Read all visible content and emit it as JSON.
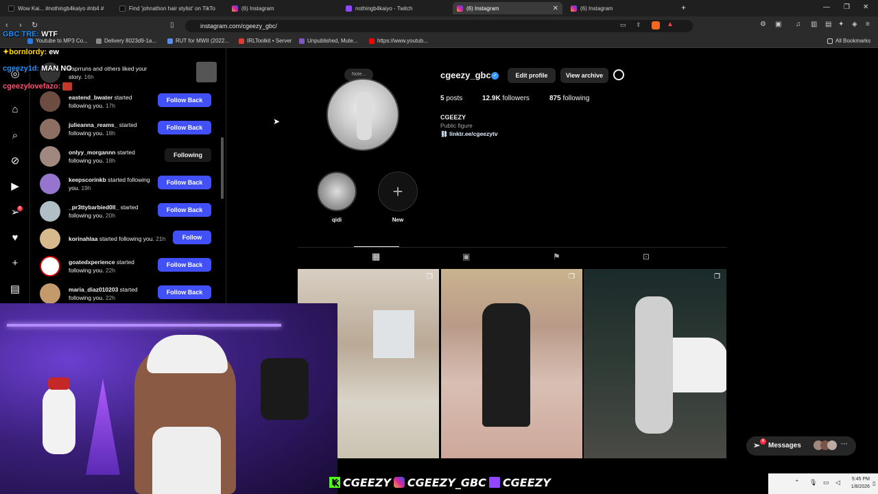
{
  "browser": {
    "tabs": [
      {
        "label": "Wow Kai... #nothingb4kaiyo #nb4 #",
        "icon": "tiktok-icon"
      },
      {
        "label": "Find 'johnathon hair stylist' on TikTo",
        "icon": "tiktok-icon"
      },
      {
        "label": "(6) Instagram",
        "icon": "instagram-icon"
      },
      {
        "label": "nothingb4kaiyo - Twitch",
        "icon": "twitch-icon"
      },
      {
        "label": "(6) Instagram",
        "icon": "instagram-icon"
      },
      {
        "label": "(6) Instagram",
        "icon": "instagram-icon"
      }
    ],
    "new_tab": "+",
    "url": "instagram.com/cgeezy_gbc/",
    "bookmarks": [
      {
        "label": "Youtube to MP3 Co..."
      },
      {
        "label": "Delivery 8023d9-1a..."
      },
      {
        "label": "RUT for MWII (2022..."
      },
      {
        "label": "IRLToolkit • Server"
      },
      {
        "label": "Unpublished, Mute..."
      },
      {
        "label": "https://www.youtub..."
      }
    ],
    "all_bookmarks": "All Bookmarks"
  },
  "chat": {
    "line1_user": "GBC TRE:",
    "line1_msg": "WTF",
    "line2_user": "bornlordy:",
    "line2_msg": "ew",
    "line3_user": "cgeezy1d:",
    "line3_msg": "MAN NO",
    "line4_user": "cgeezylovefazo:"
  },
  "notifications": [
    {
      "user": "",
      "text": "kaprruns and others liked your story.",
      "time": "16h",
      "button": ""
    },
    {
      "user": "eastend_bwater",
      "text": " started following you.",
      "time": "17h",
      "button": "Follow Back"
    },
    {
      "user": "julieanna_reams_",
      "text": " started following you.",
      "time": "18h",
      "button": "Follow Back"
    },
    {
      "user": "onlyy_morgannn",
      "text": " started following you.",
      "time": "18h",
      "button": "Following"
    },
    {
      "user": "keepscorinkb",
      "text": " started following you.",
      "time": "19h",
      "button": "Follow Back"
    },
    {
      "user": "_pr3ttybarbied0ll_",
      "text": " started following you.",
      "time": "20h",
      "button": "Follow Back"
    },
    {
      "user": "korinahlaa",
      "text": " started following you.",
      "time": "21h",
      "button": "Follow"
    },
    {
      "user": "goatedxperience",
      "text": " started following you.",
      "time": "22h",
      "button": "Follow Back"
    },
    {
      "user": "maria_diaz010203",
      "text": " started following you.",
      "time": "22h",
      "button": "Follow Back"
    }
  ],
  "profile": {
    "note": "Note...",
    "username": "cgeezy_gbc",
    "edit_profile": "Edit profile",
    "view_archive": "View archive",
    "posts_count": "5",
    "posts_label": "posts",
    "followers_count": "12.9K",
    "followers_label": "followers",
    "following_count": "875",
    "following_label": "following",
    "display_name": "CGEEZY",
    "category": "Public figure",
    "link": "linktr.ee/cgeezytv",
    "highlight_label": "qidi",
    "new_label": "New"
  },
  "messages": {
    "label": "Messages",
    "badge": "6"
  },
  "rail": {
    "notif_badge": "6"
  },
  "banner": {
    "kick": "CGEEZY",
    "instagram": "CGEEZY_GBC",
    "twitch": "CGEEZY"
  },
  "taskbar": {
    "time": "5:45 PM",
    "date": "1/8/2026"
  }
}
